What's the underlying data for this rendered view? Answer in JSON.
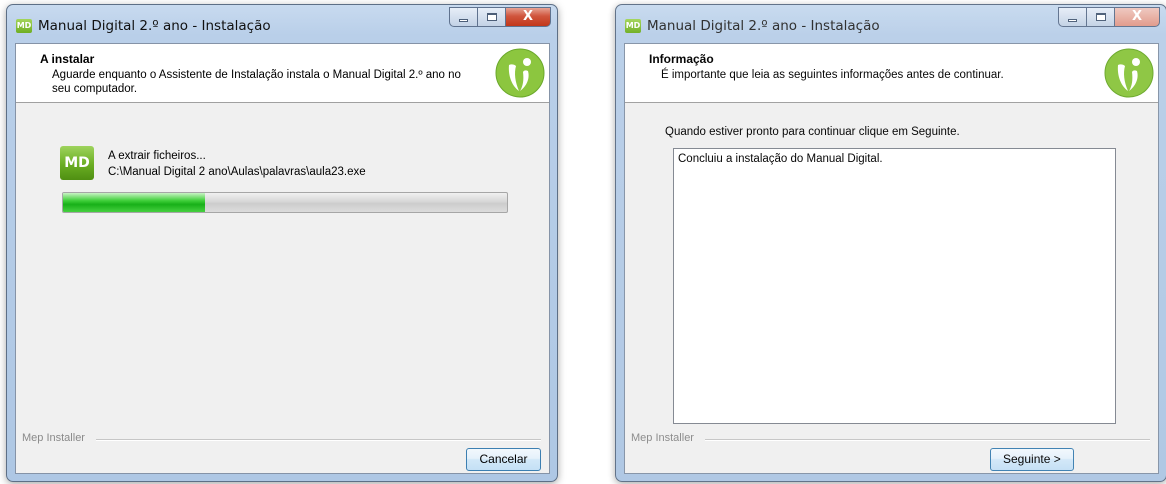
{
  "left_window": {
    "title": "Manual Digital 2.º ano - Instalação",
    "app_icon": "MD",
    "header_title": "A instalar",
    "header_subtitle": "Aguarde enquanto o Assistente de Instalação instala o Manual Digital 2.º ano no seu computador.",
    "product_icon": "MD",
    "status_text": "A extrair ficheiros...",
    "file_path": "C:\\Manual Digital 2 ano\\Aulas\\palavras\\aula23.exe",
    "progress_fraction": 0.32,
    "footer_label": "Mep Installer",
    "cancel_label": "Cancelar",
    "close_glyph": "X"
  },
  "right_window": {
    "title": "Manual Digital 2.º ano - Instalação",
    "app_icon": "MD",
    "header_title": "Informação",
    "header_subtitle": "É importante que leia as seguintes informações antes de continuar.",
    "prompt": "Quando estiver pronto para continuar clique em Seguinte.",
    "info_text": "Concluiu a instalação do Manual Digital.",
    "footer_label": "Mep Installer",
    "next_label": "Seguinte >",
    "close_glyph": "X"
  },
  "colors": {
    "accent_green": "#6aad22",
    "progress_green": "#18b018",
    "close_red": "#c2371a"
  },
  "icons": [
    "minimize-icon",
    "maximize-icon",
    "close-icon",
    "brand-logo-icon",
    "md-app-icon"
  ]
}
